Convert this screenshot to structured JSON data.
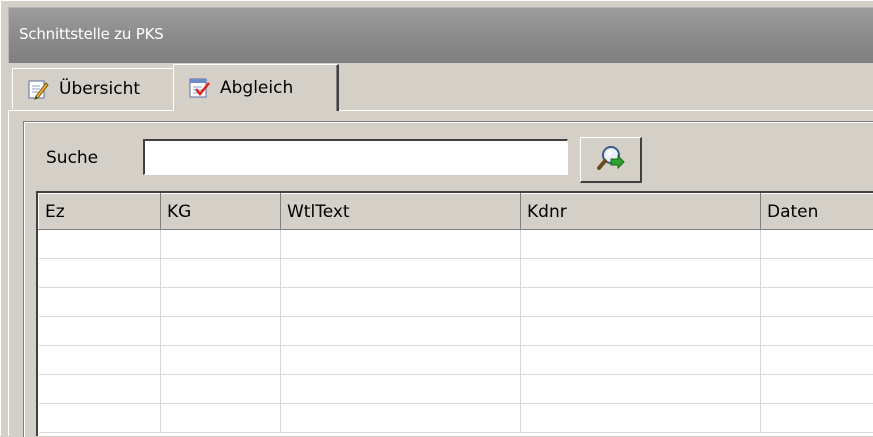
{
  "window": {
    "title": "Schnittstelle zu PKS"
  },
  "tabs": [
    {
      "label": "Übersicht",
      "icon": "edit-document-icon",
      "active": false
    },
    {
      "label": "Abgleich",
      "icon": "checklist-icon",
      "active": true
    }
  ],
  "search": {
    "label": "Suche",
    "value": "",
    "button_icon": "search-go-icon"
  },
  "table": {
    "columns": [
      "Ez",
      "KG",
      "WtlText",
      "Kdnr",
      "Daten"
    ],
    "rows": [
      [
        "",
        "",
        "",
        "",
        ""
      ],
      [
        "",
        "",
        "",
        "",
        ""
      ],
      [
        "",
        "",
        "",
        "",
        ""
      ],
      [
        "",
        "",
        "",
        "",
        ""
      ],
      [
        "",
        "",
        "",
        "",
        ""
      ],
      [
        "",
        "",
        "",
        "",
        ""
      ],
      [
        "",
        "",
        "",
        "",
        ""
      ]
    ]
  },
  "colors": {
    "face": "#d4d0c8",
    "title_bar": "#8a8a8a",
    "title_text": "#ffffff",
    "grid_background": "#ffffff"
  }
}
